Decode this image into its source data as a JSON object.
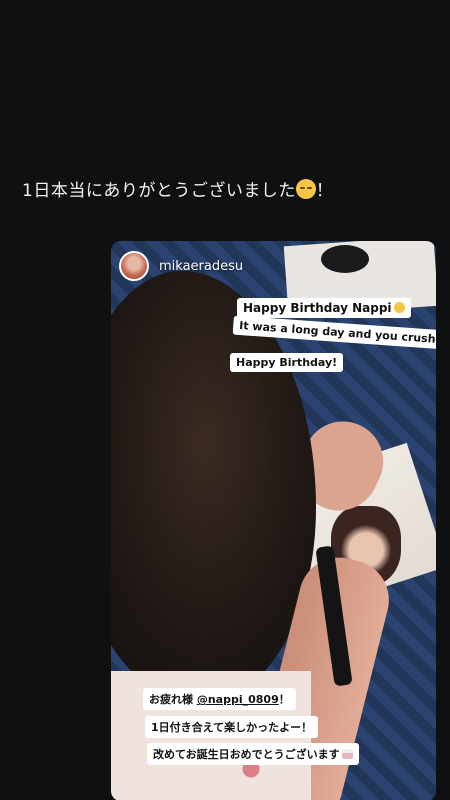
{
  "story": {
    "caption": "1日本当にありがとうございました",
    "caption_suffix": "！",
    "caption_emoji": "relieved-face-icon"
  },
  "repost": {
    "username": "mikaeradesu",
    "avatar_icon": "avatar-photo",
    "stickers_top": [
      "Happy Birthday Nappi",
      "It was a long day and you crushed it.",
      "Happy Birthday!"
    ],
    "sticker_1_emoji": "hugging-face-icon",
    "stickers_bottom": {
      "line1_prefix": "お疲れ様 ",
      "line1_mention": "@nappi_0809",
      "line1_suffix": "！",
      "line2": "1日付き合えて楽しかったよー！",
      "line3": "改めてお誕生日おめでとうございます",
      "line3_emoji": "birthday-cake-icon"
    }
  },
  "colors": {
    "background": "#0f1011",
    "sticker_bg": "#ffffff",
    "sticker_text": "#111111"
  }
}
